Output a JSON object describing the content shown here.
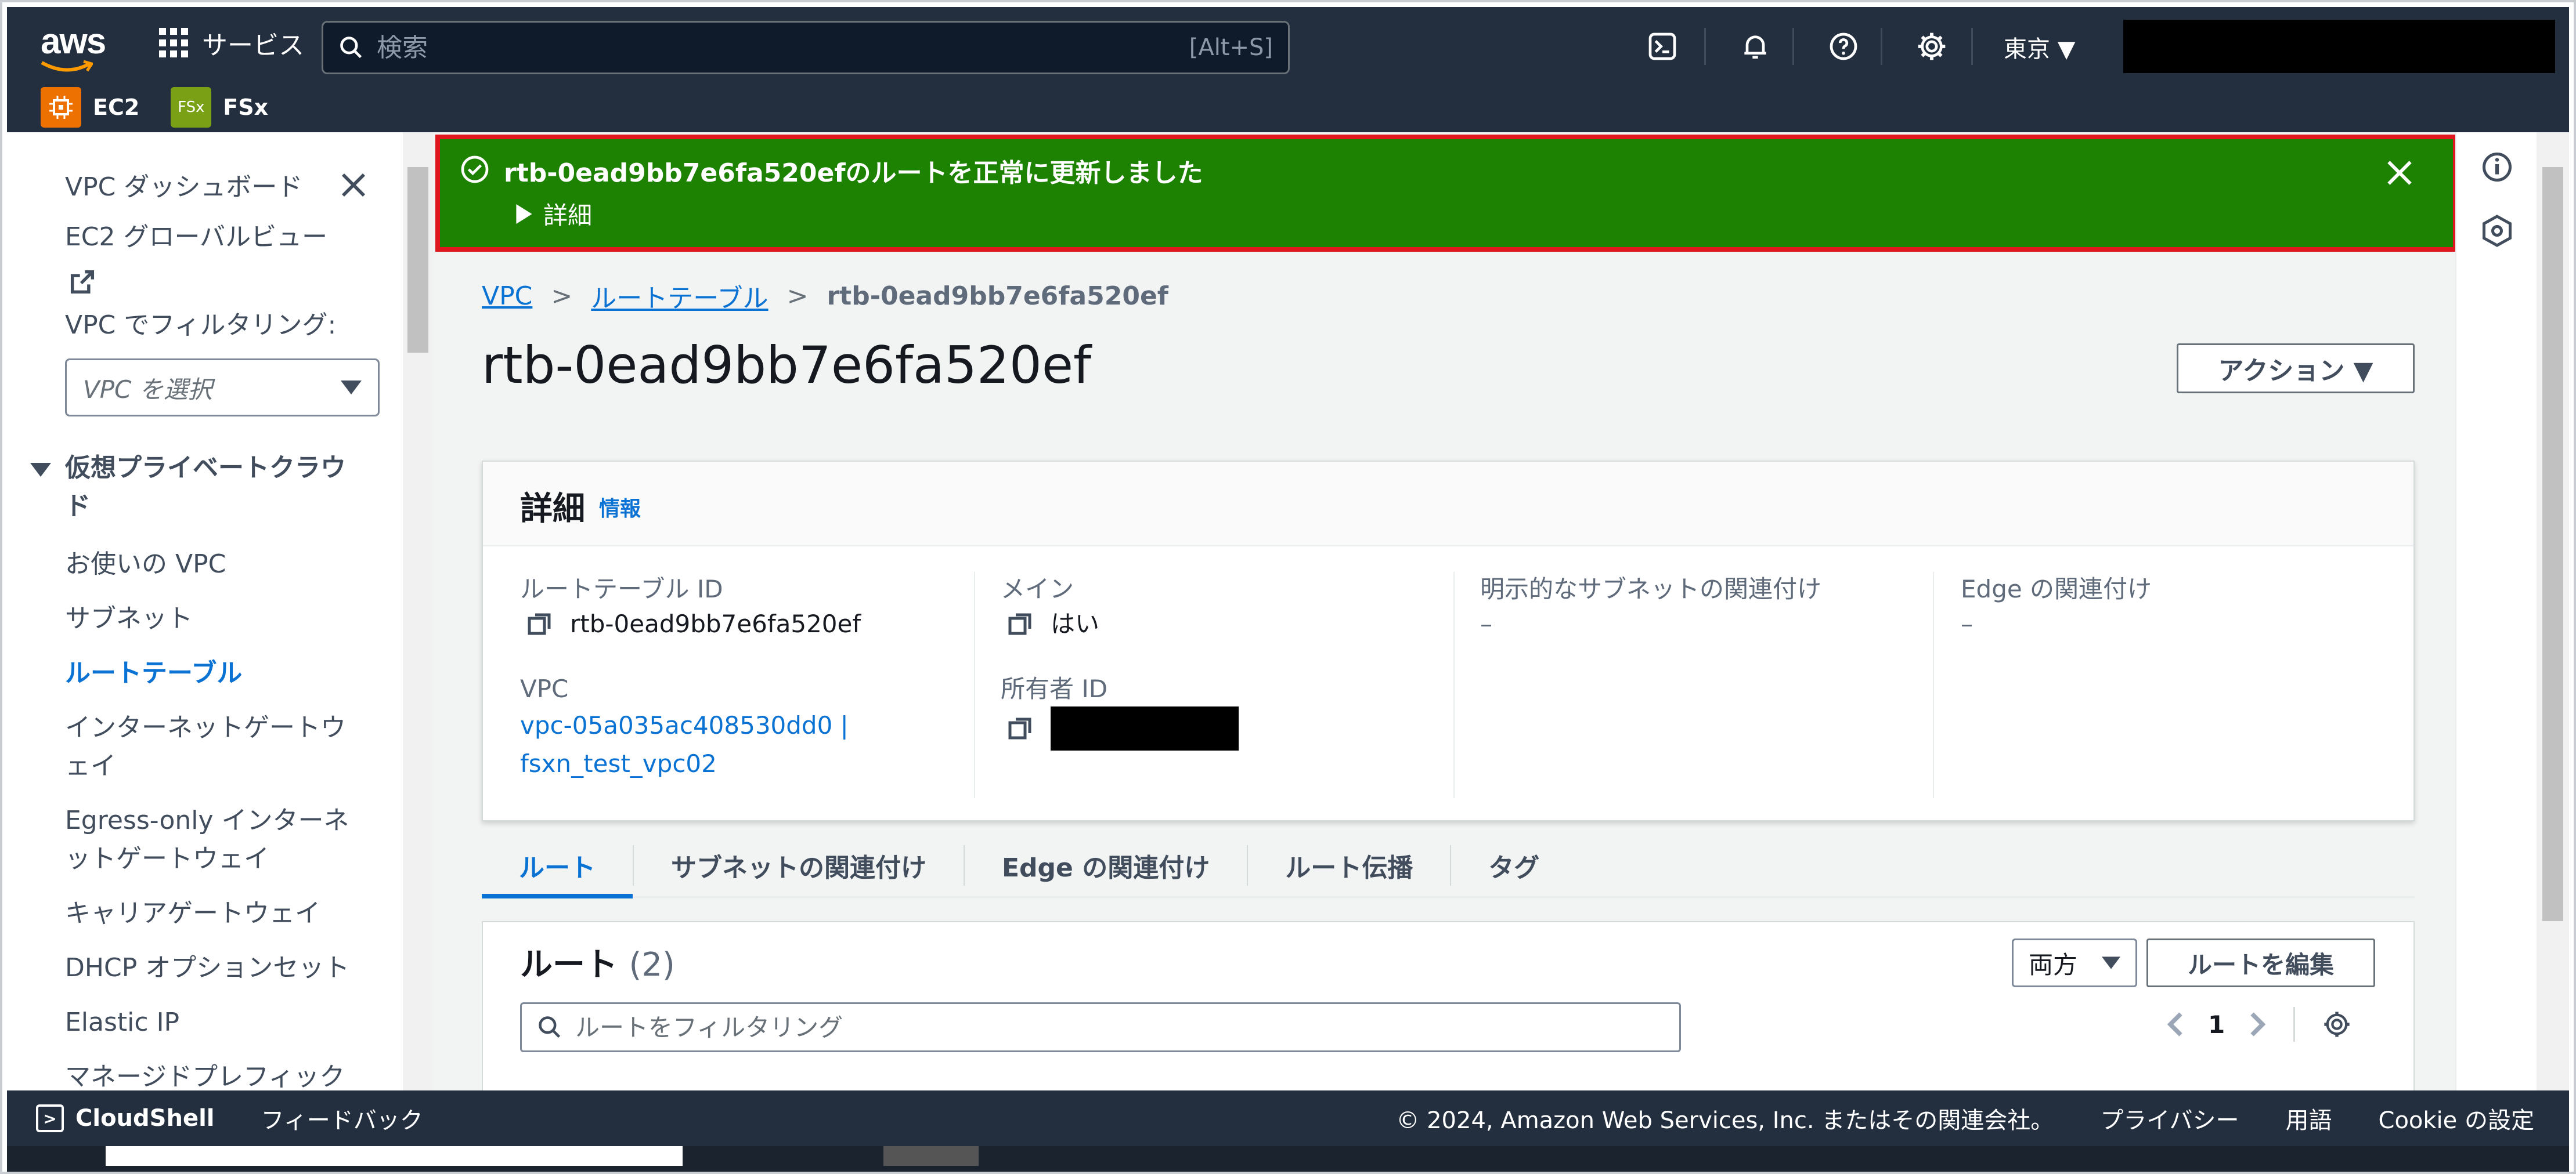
{
  "topnav": {
    "logo": "aws",
    "services_label": "サービス",
    "search_placeholder": "検索",
    "search_shortcut": "[Alt+S]",
    "region": "東京 ▼",
    "icons": [
      "cloudshell-icon",
      "bell-icon",
      "help-icon",
      "gear-icon"
    ]
  },
  "favorites": [
    {
      "label": "EC2",
      "badge": "",
      "color": "#ed7100"
    },
    {
      "label": "FSx",
      "badge": "FSx",
      "color": "#7aa116"
    }
  ],
  "sidebar": {
    "dashboard": "VPC ダッシュボード",
    "ec2_global_view": "EC2 グローバルビュー",
    "filter_label": "VPC でフィルタリング:",
    "filter_placeholder": "VPC を選択",
    "section_title": "仮想プライベートクラウド",
    "items": [
      {
        "label": "お使いの VPC",
        "active": false
      },
      {
        "label": "サブネット",
        "active": false
      },
      {
        "label": "ルートテーブル",
        "active": true
      },
      {
        "label": "インターネットゲートウェイ",
        "active": false
      },
      {
        "label": "Egress-only インターネットゲートウェイ",
        "active": false
      },
      {
        "label": "キャリアゲートウェイ",
        "active": false
      },
      {
        "label": "DHCP オプションセット",
        "active": false
      },
      {
        "label": "Elastic IP",
        "active": false
      },
      {
        "label": "マネージドプレフィックス",
        "active": false
      }
    ]
  },
  "flash": {
    "message": "rtb-0ead9bb7e6fa520efのルートを正常に更新しました",
    "detail": "詳細",
    "color": "#1d8102"
  },
  "breadcrumb": [
    "VPC",
    "ルートテーブル",
    "rtb-0ead9bb7e6fa520ef"
  ],
  "page": {
    "title": "rtb-0ead9bb7e6fa520ef",
    "action_label": "アクション ▼"
  },
  "details": {
    "title": "詳細",
    "info": "情報",
    "route_table_id_label": "ルートテーブル ID",
    "route_table_id": "rtb-0ead9bb7e6fa520ef",
    "vpc_label": "VPC",
    "vpc_link_1": "vpc-05a035ac408530dd0 |",
    "vpc_link_2": "fsxn_test_vpc02",
    "main_label": "メイン",
    "main_value": "はい",
    "owner_label": "所有者 ID",
    "explicit_subnet_label": "明示的なサブネットの関連付け",
    "explicit_subnet_value": "–",
    "edge_label": "Edge の関連付け",
    "edge_value": "–"
  },
  "tabs": [
    "ルート",
    "サブネットの関連付け",
    "Edge の関連付け",
    "ルート伝播",
    "タグ"
  ],
  "routes": {
    "title": "ルート",
    "count": "(2)",
    "both_label": "両方",
    "edit_label": "ルートを編集",
    "filter_placeholder": "ルートをフィルタリング",
    "page_num": "1"
  },
  "footer": {
    "cloudshell": "CloudShell",
    "feedback": "フィードバック",
    "copyright": "© 2024, Amazon Web Services, Inc. またはその関連会社。",
    "privacy": "プライバシー",
    "terms": "用語",
    "cookie": "Cookie の設定"
  }
}
